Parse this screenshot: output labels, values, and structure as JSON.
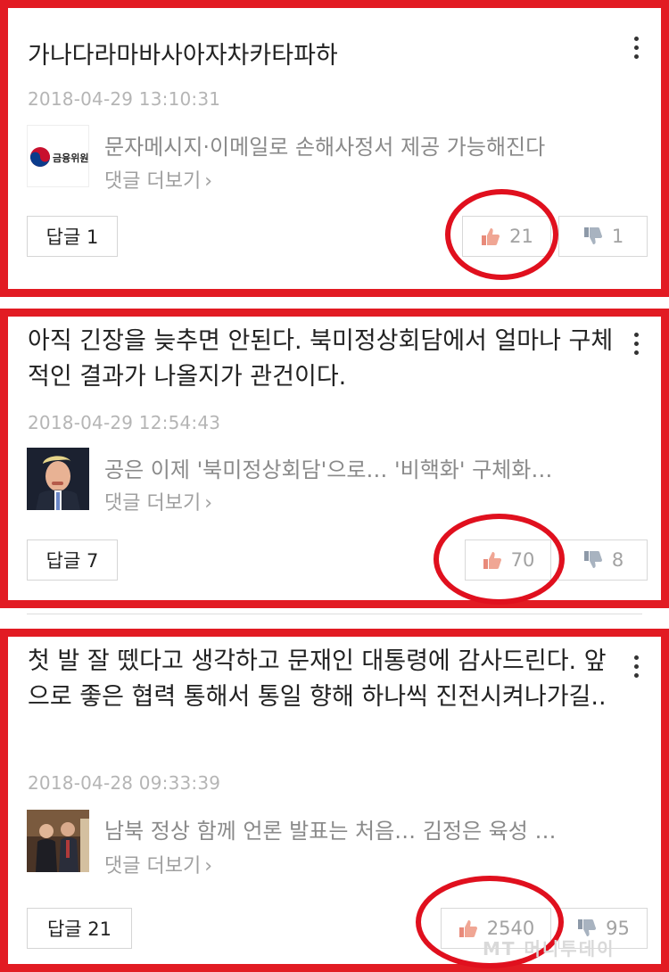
{
  "comments": [
    {
      "text": "가나다라마바사아자차카타파하",
      "timestamp": "2018-04-29 13:10:31",
      "news_title": "문자메시지·이메일로 손해사정서 제공 가능해진다",
      "news_thumb_text": "금융위원회",
      "more_comments": "댓글 더보기",
      "reply_label": "답글 1",
      "like_count": "21",
      "dislike_count": "1"
    },
    {
      "text": "아직 긴장을 늦추면 안된다. 북미정상회담에서 얼마나 구체적인 결과가 나올지가 관건이다.",
      "timestamp": "2018-04-29 12:54:43",
      "news_title": "공은 이제 '북미정상회담'으로… '비핵화' 구체화…",
      "more_comments": "댓글 더보기",
      "reply_label": "답글 7",
      "like_count": "70",
      "dislike_count": "8"
    },
    {
      "text": "첫 발 잘 뗐다고 생각하고 문재인 대통령에 감사드린다. 앞으로 좋은 협력 통해서 통일 향해 하나씩 진전시켜나가길..",
      "timestamp": "2018-04-28 09:33:39",
      "news_title": "남북 정상 함께 언론 발표는 처음… 김정은 육성 …",
      "more_comments": "댓글 더보기",
      "reply_label": "답글 21",
      "like_count": "2540",
      "dislike_count": "95"
    }
  ],
  "icons": {
    "more": "more-vertical-icon",
    "like": "thumbs-up-icon",
    "dislike": "thumbs-down-icon",
    "chevron": "chevron-right-icon"
  },
  "watermark": "MT 머니투데이",
  "colors": {
    "highlight": "#e21b23",
    "like_icon": "#e88a7a",
    "dislike_icon": "#9aa6b4"
  }
}
